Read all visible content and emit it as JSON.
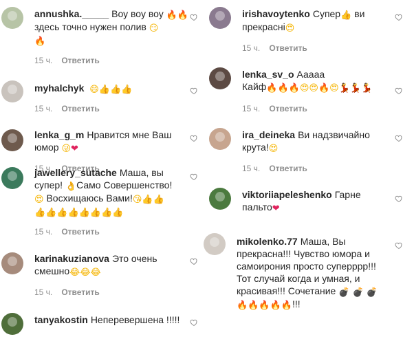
{
  "reply_label": "Ответить",
  "colors": {
    "heart_outline": "#8e8e8e",
    "meta": "#8e8e8e",
    "text": "#262626"
  },
  "left_comments": [
    {
      "username": "annushka._____",
      "text": "Воу воу воу",
      "line2": "здесь точно нужен полив",
      "time": "15 ч.",
      "avatar_color": "#b7c4a6"
    },
    {
      "username": "myhalchyk",
      "text": "",
      "time": "15 ч.",
      "avatar_color": "#c9c3bd"
    },
    {
      "username": "lenka_g_m",
      "text": "Нравится мне Ваш",
      "line2": "юмор",
      "time": "15 ч.",
      "avatar_color": "#6e5a4d"
    },
    {
      "username": "jawellery_sutache",
      "text": "Маша, вы",
      "line2": "супер!",
      "line2b": "Само Совершенство!",
      "line3": "Восхищаюсь Вами!",
      "time": "15 ч.",
      "avatar_color": "#3b7a5c"
    },
    {
      "username": "karinakuzianova",
      "text": "Это очень",
      "line2": "смешно",
      "time": "15 ч.",
      "avatar_color": "#a68b7c"
    },
    {
      "username": "tanyakostin",
      "text": "Неперевершена !!!!!",
      "avatar_color": "#4f6e3a"
    }
  ],
  "right_comments": [
    {
      "username": "irishavoytenko",
      "text": "Супер",
      "line2": "ви",
      "line2b": "прекрасні",
      "time": "15 ч.",
      "avatar_color": "#8a7a8f"
    },
    {
      "username": "lenka_sv_o",
      "text": "Ааааа",
      "line2": "Кайф",
      "time": "15 ч.",
      "avatar_color": "#5c4a43"
    },
    {
      "username": "ira_deineka",
      "text": "Ви надзвичайно",
      "line2": "крута!",
      "time": "15 ч.",
      "avatar_color": "#c7a58f"
    },
    {
      "username": "viktoriiapeleshenko",
      "text": "Гарне",
      "line2": "пальто",
      "avatar_color": "#4b7a3f"
    },
    {
      "username": "mikolenko.77",
      "text": "Маша, Вы",
      "line2": "прекрасна!!!",
      "line2b": "Чувство юмора и",
      "line3": "самоирония просто суперррр!!!",
      "line4": "Тот случай когда и умная, и",
      "line5": "красивая!!!",
      "line5b": "Сочетание",
      "line6b": "!!!",
      "avatar_color": "#d2cbc4"
    }
  ]
}
